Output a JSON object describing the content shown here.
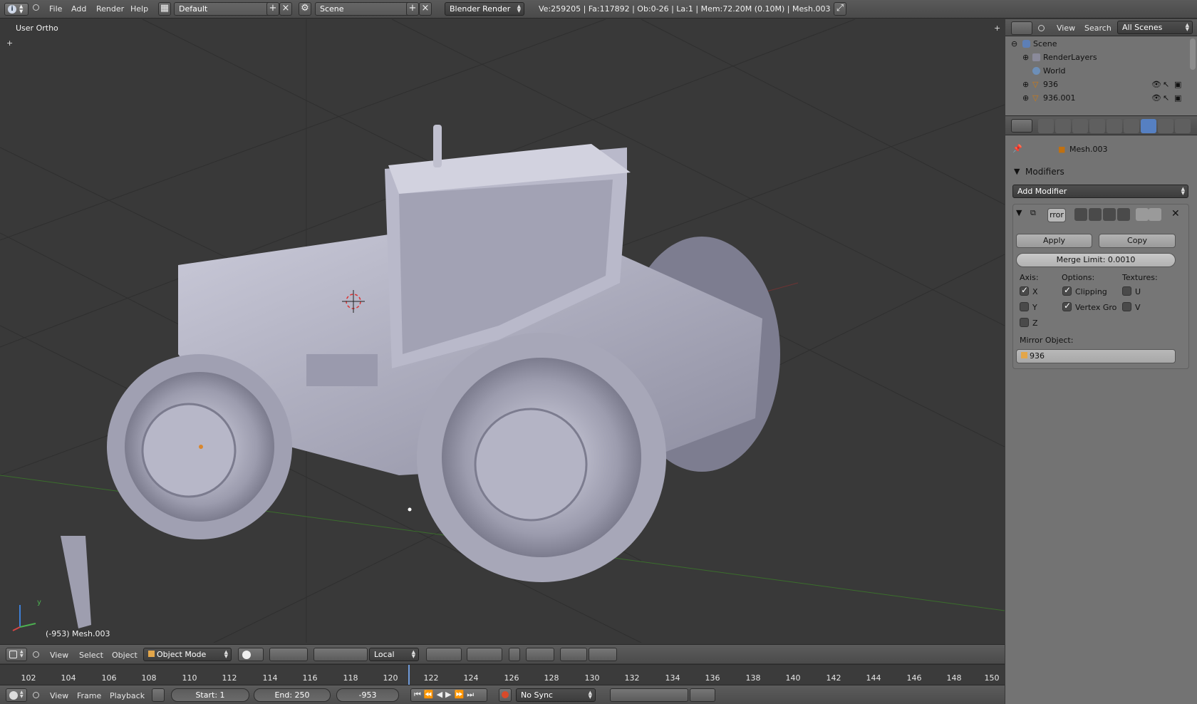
{
  "topbar": {
    "menus": [
      "File",
      "Add",
      "Render",
      "Help"
    ],
    "screen_layout": "Default",
    "scene": "Scene",
    "render_engine": "Blender Render",
    "stats": "Ve:259205 | Fa:117892 | Ob:0-26 | La:1 | Mem:72.20M (0.10M) | Mesh.003"
  },
  "viewport": {
    "view_label": "User Ortho",
    "object_info": "(-953) Mesh.003",
    "axis_y": "y"
  },
  "viewport_header": {
    "menus": [
      "View",
      "Select",
      "Object"
    ],
    "mode": "Object Mode",
    "pivot": "Local"
  },
  "timeline": {
    "frames": [
      "102",
      "104",
      "106",
      "108",
      "110",
      "112",
      "114",
      "116",
      "118",
      "120",
      "122",
      "124",
      "126",
      "128",
      "130",
      "132",
      "134",
      "136",
      "138",
      "140",
      "142",
      "144",
      "146",
      "148",
      "150"
    ],
    "menus": [
      "View",
      "Frame",
      "Playback"
    ],
    "start": "Start: 1",
    "end": "End: 250",
    "current": "-953",
    "sync": "No Sync"
  },
  "outliner": {
    "menus": [
      "View",
      "Search"
    ],
    "filter": "All Scenes",
    "rows": [
      "Scene",
      "RenderLayers",
      "World",
      "936",
      "936.001"
    ]
  },
  "properties": {
    "context": "Mesh.003",
    "panel_title": "Modifiers",
    "add_modifier": "Add Modifier",
    "modifier_name": "rror",
    "apply_label": "Apply",
    "copy_label": "Copy",
    "merge_limit": "Merge Limit: 0.0010",
    "axis_label": "Axis:",
    "options_label": "Options:",
    "textures_label": "Textures:",
    "axis_x": "X",
    "axis_y": "Y",
    "axis_z": "Z",
    "clipping": "Clipping",
    "vertex_group": "Vertex Gro",
    "tex_u": "U",
    "tex_v": "V",
    "mirror_object_label": "Mirror Object:",
    "mirror_object": "936"
  }
}
